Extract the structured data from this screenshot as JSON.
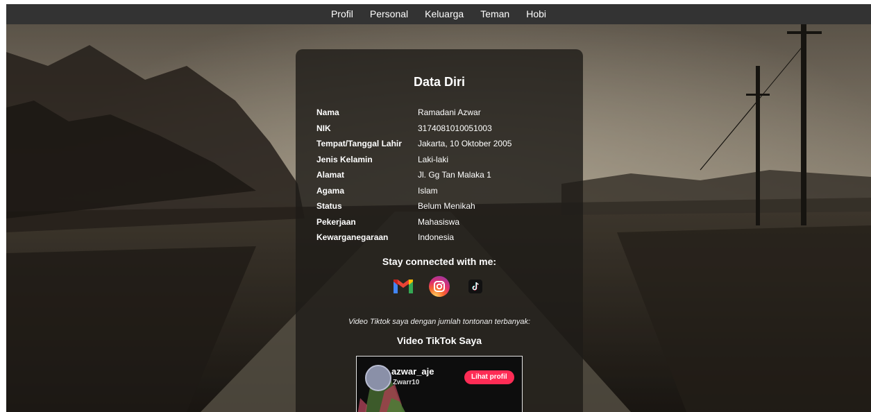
{
  "nav": {
    "items": [
      {
        "label": "Profil"
      },
      {
        "label": "Personal"
      },
      {
        "label": "Keluarga"
      },
      {
        "label": "Teman"
      },
      {
        "label": "Hobi"
      }
    ]
  },
  "card": {
    "title": "Data Diri",
    "rows": [
      {
        "label": "Nama",
        "value": "Ramadani Azwar"
      },
      {
        "label": "NIK",
        "value": "3174081010051003"
      },
      {
        "label": "Tempat/Tanggal Lahir",
        "value": "Jakarta, 10 Oktober 2005"
      },
      {
        "label": "Jenis Kelamin",
        "value": "Laki-laki"
      },
      {
        "label": "Alamat",
        "value": "Jl. Gg Tan Malaka 1"
      },
      {
        "label": "Agama",
        "value": "Islam"
      },
      {
        "label": "Status",
        "value": "Belum Menikah"
      },
      {
        "label": "Pekerjaan",
        "value": "Mahasiswa"
      },
      {
        "label": "Kewarganegaraan",
        "value": "Indonesia"
      }
    ],
    "stay_connected": "Stay connected with me:",
    "socials": [
      {
        "icon": "gmail-icon"
      },
      {
        "icon": "instagram-icon"
      },
      {
        "icon": "tiktok-icon"
      }
    ],
    "video_caption": "Video Tiktok saya dengan jumlah tontonan terbanyak:",
    "video_title": "Video TikTok Saya",
    "tiktok": {
      "username": "azwar_aje",
      "handle": "Zwarr10",
      "button": "Lihat profil"
    }
  },
  "colors": {
    "nav_bg": "#333333",
    "tiktok_button": "#fe2c55"
  }
}
